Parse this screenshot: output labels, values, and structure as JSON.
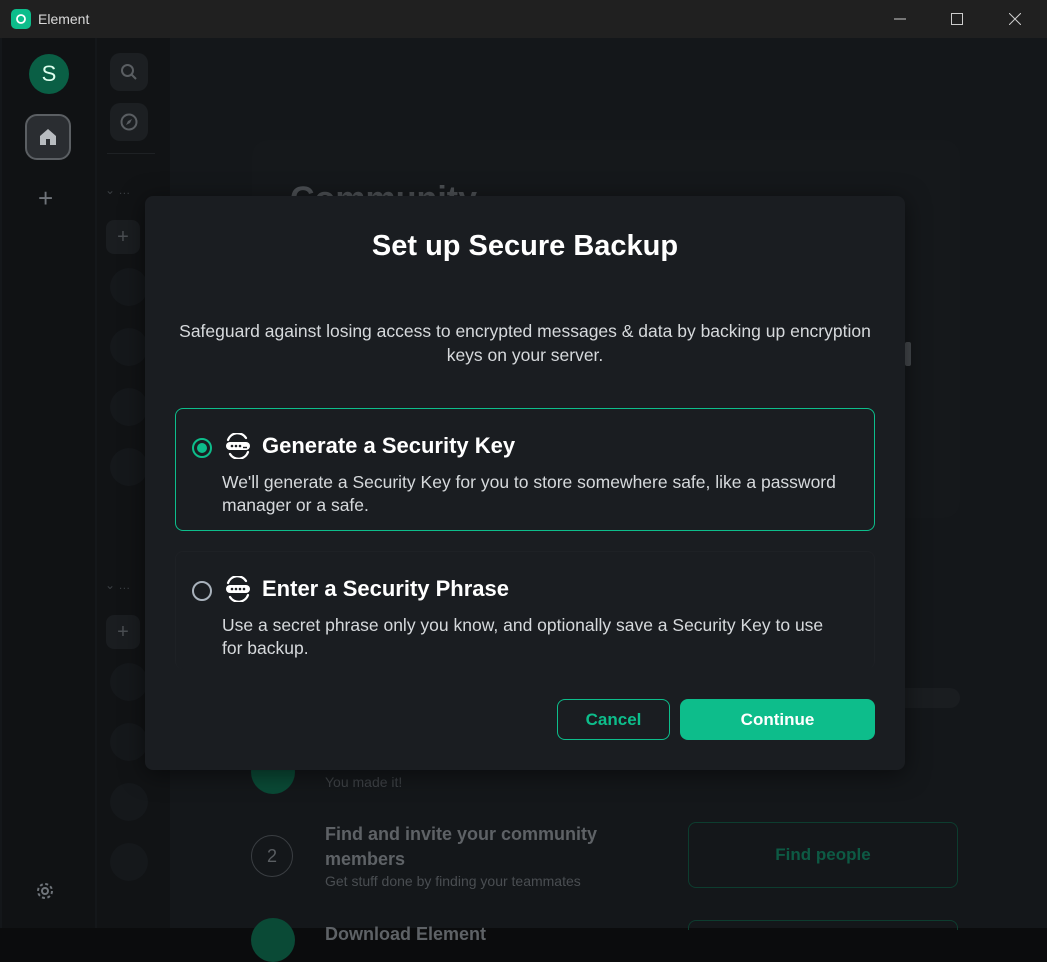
{
  "window": {
    "title": "Element"
  },
  "space_panel": {
    "avatar_letter": "S"
  },
  "room_panel": {
    "section_label": "…"
  },
  "background": {
    "heading": "Community",
    "steps": [
      {
        "subtitle": "You made it!"
      },
      {
        "number": "2",
        "title": "Find and invite your community members",
        "subtitle": "Get stuff done by finding your teammates",
        "button": "Find people"
      },
      {
        "title": "Download Element"
      }
    ]
  },
  "dialog": {
    "title": "Set up Secure Backup",
    "description": "Safeguard against losing access to encrypted messages & data by backing up encryption keys on your server.",
    "options": [
      {
        "title": "Generate a Security Key",
        "description": "We'll generate a Security Key for you to store somewhere safe, like a password manager or a safe.",
        "selected": true
      },
      {
        "title": "Enter a Security Phrase",
        "description": "Use a secret phrase only you know, and optionally save a Security Key to use for backup.",
        "selected": false
      }
    ],
    "cancel_label": "Cancel",
    "continue_label": "Continue"
  },
  "colors": {
    "accent": "#0dbd8b",
    "dialog_bg": "#1a1d21",
    "app_bg": "#14171a"
  }
}
